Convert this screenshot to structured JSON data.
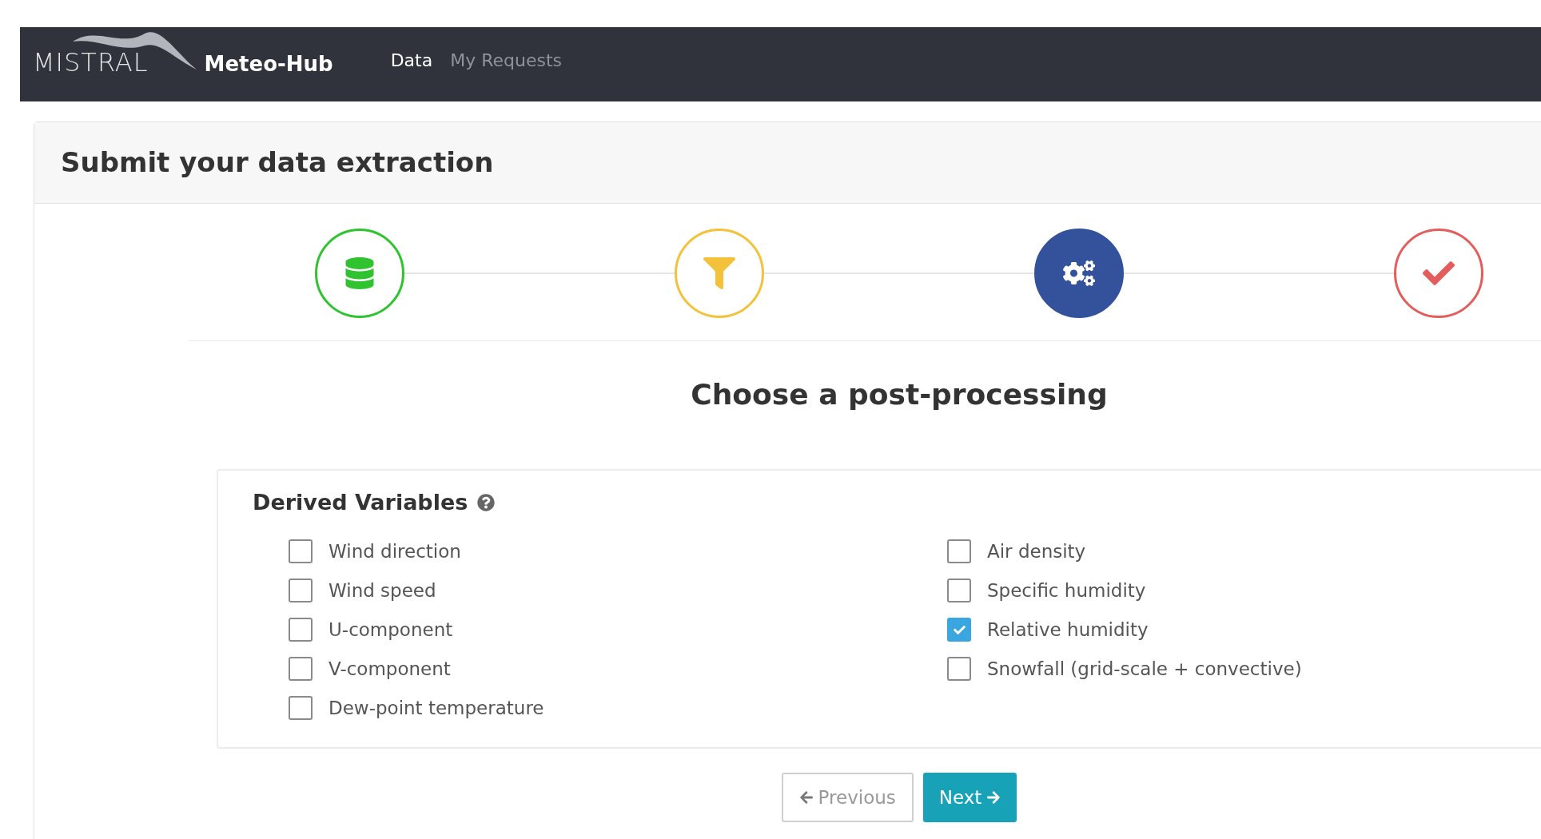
{
  "navbar": {
    "brand": "MISTRAL",
    "app_name": "Meteo-Hub",
    "links": [
      {
        "label": "Data",
        "selected": true
      },
      {
        "label": "My Requests",
        "selected": false
      }
    ]
  },
  "card": {
    "title": "Submit your data extraction"
  },
  "steps": [
    {
      "kind": "dataset",
      "color": "#2fc42f",
      "selected": false
    },
    {
      "kind": "filter",
      "color": "#f3c13a",
      "selected": false
    },
    {
      "kind": "postprocess",
      "color": "#34529b",
      "selected": true
    },
    {
      "kind": "submit",
      "color": "#e35d5d",
      "selected": false
    }
  ],
  "step_title": "Choose a post-processing",
  "panel": {
    "title": "Derived Variables",
    "columns": [
      [
        {
          "label": "Wind direction",
          "checked": false
        },
        {
          "label": "Wind speed",
          "checked": false
        },
        {
          "label": "U-component",
          "checked": false
        },
        {
          "label": "V-component",
          "checked": false
        },
        {
          "label": "Dew-point temperature",
          "checked": false
        }
      ],
      [
        {
          "label": "Air density",
          "checked": false
        },
        {
          "label": "Specific humidity",
          "checked": false
        },
        {
          "label": "Relative humidity",
          "checked": true
        },
        {
          "label": "Snowfall (grid-scale + convective)",
          "checked": false
        }
      ]
    ]
  },
  "buttons": {
    "previous": "Previous",
    "next": "Next"
  }
}
